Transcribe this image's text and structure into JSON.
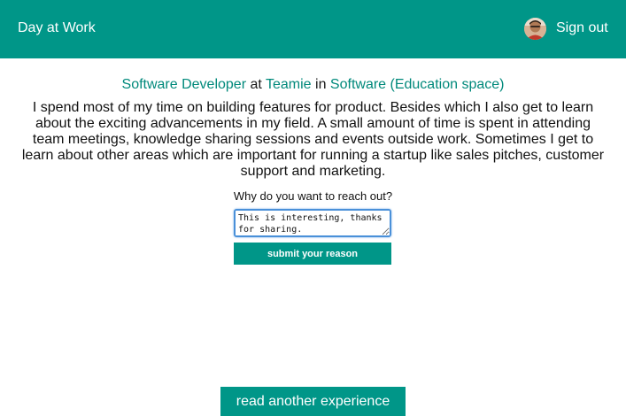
{
  "navbar": {
    "brand": "Day at Work",
    "avatar_icon": "user-avatar-photo",
    "sign_out": "Sign out",
    "background": "#009688"
  },
  "experience": {
    "role": "Software Developer",
    "at_word": "at",
    "company": "Teamie",
    "in_word": "in",
    "industry": "Software (Education space)",
    "description": "I spend most of my time on building features for product. Besides which I also get to learn about the exciting advancements in my field. A small amount of time is spent in attending team meetings, knowledge sharing sessions and events outside work. Sometimes I get to learn about other areas which are important for running a startup like sales pitches, customer support and marketing."
  },
  "reach_out": {
    "label": "Why do you want to reach out?",
    "value": "This is interesting, thanks for sharing.",
    "submit_label": "submit your reason"
  },
  "footer": {
    "another_label": "read another experience"
  },
  "colors": {
    "accent": "#009688",
    "link": "#00897b",
    "focus_ring": "#4a90d9"
  }
}
